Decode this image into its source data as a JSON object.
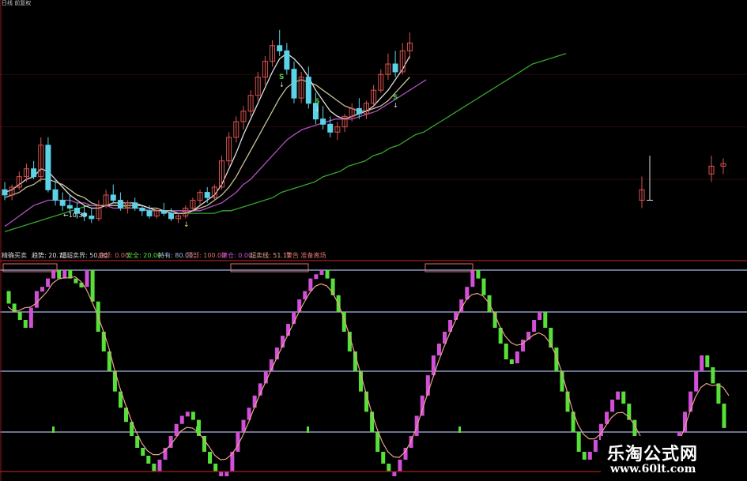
{
  "top_title": "日线 前复权",
  "colors": {
    "background": "#000000",
    "frame": "#8b1a1a",
    "up_candle": "#d9534f",
    "down_candle": "#5bd2e8",
    "ma_short": "#e0e0e0",
    "ma_mid": "#c9c19a",
    "ma_long": "#b24fc2",
    "ma_slow": "#36a62e",
    "osc_up": "#d24fd8",
    "osc_down": "#58e03a",
    "osc_line": "#e8a488",
    "level_line": "#a9b7e6",
    "buy_signal": "#4fd04f"
  },
  "indicator_labels": [
    {
      "text": "精确买卖",
      "color": "#cccccc"
    },
    {
      "text": "趋势: 20.73",
      "color": "#e0e0e0"
    },
    {
      "text": "超超卖界: 50.00",
      "color": "#cccccc"
    },
    {
      "text": "底部: 0.00",
      "color": "#e07070"
    },
    {
      "text": "安全: 20.00",
      "color": "#58e03a"
    },
    {
      "text": "持有: 80.00",
      "color": "#a9b7e6"
    },
    {
      "text": "顶部: 100.00",
      "color": "#e07070"
    },
    {
      "text": "建仓: 0.00",
      "color": "#d24fd8"
    },
    {
      "text": "超卖线: 51.17",
      "color": "#e8a488"
    },
    {
      "text": "警告 准备离场",
      "color": "#e07070"
    }
  ],
  "annotations": {
    "price_low_label": "10.33",
    "signal_marker": "S"
  },
  "watermark": {
    "name": "乐淘公式网",
    "url": "www.60lt.com"
  },
  "chart_data": [
    {
      "type": "candlestick",
      "title": "",
      "description_levels": "price panel with four moving averages",
      "candles": [
        [
          11.6,
          11.9,
          11.2,
          11.4
        ],
        [
          11.4,
          11.8,
          11.2,
          11.7
        ],
        [
          11.7,
          12.3,
          11.6,
          12.1
        ],
        [
          12.1,
          12.6,
          11.9,
          12.4
        ],
        [
          12.4,
          12.7,
          12.0,
          12.1
        ],
        [
          12.1,
          13.6,
          11.9,
          13.3
        ],
        [
          13.3,
          13.6,
          11.5,
          11.6
        ],
        [
          11.6,
          12.0,
          11.0,
          11.2
        ],
        [
          11.2,
          11.5,
          10.8,
          11.0
        ],
        [
          11.0,
          11.4,
          10.7,
          10.9
        ],
        [
          10.9,
          11.1,
          10.5,
          10.7
        ],
        [
          10.7,
          11.0,
          10.4,
          10.6
        ],
        [
          10.6,
          10.9,
          10.33,
          10.5
        ],
        [
          10.5,
          11.2,
          10.4,
          11.0
        ],
        [
          11.0,
          11.6,
          10.9,
          11.4
        ],
        [
          11.4,
          11.8,
          11.1,
          11.2
        ],
        [
          11.2,
          11.5,
          10.8,
          10.9
        ],
        [
          10.9,
          11.2,
          10.7,
          11.1
        ],
        [
          11.1,
          11.3,
          10.8,
          10.9
        ],
        [
          10.9,
          11.0,
          10.6,
          10.8
        ],
        [
          10.8,
          11.0,
          10.5,
          10.6
        ],
        [
          10.6,
          10.9,
          10.5,
          10.8
        ],
        [
          10.8,
          11.1,
          10.6,
          10.7
        ],
        [
          10.7,
          10.9,
          10.4,
          10.5
        ],
        [
          10.5,
          10.7,
          10.33,
          10.6
        ],
        [
          10.6,
          11.0,
          10.5,
          10.9
        ],
        [
          10.9,
          11.3,
          10.8,
          11.2
        ],
        [
          11.2,
          11.6,
          11.0,
          11.5
        ],
        [
          11.5,
          11.7,
          11.1,
          11.3
        ],
        [
          11.3,
          11.8,
          11.2,
          11.7
        ],
        [
          11.7,
          12.9,
          11.6,
          12.7
        ],
        [
          12.7,
          13.8,
          12.5,
          13.6
        ],
        [
          13.6,
          14.4,
          13.4,
          14.2
        ],
        [
          14.2,
          14.8,
          13.9,
          14.6
        ],
        [
          14.6,
          15.4,
          14.4,
          15.2
        ],
        [
          15.2,
          16.1,
          15.0,
          15.9
        ],
        [
          15.9,
          16.7,
          15.6,
          16.5
        ],
        [
          16.5,
          17.3,
          16.3,
          17.1
        ],
        [
          17.1,
          17.7,
          16.7,
          16.9
        ],
        [
          16.9,
          17.2,
          16.0,
          16.2
        ],
        [
          16.2,
          16.5,
          14.9,
          15.1
        ],
        [
          15.1,
          16.1,
          14.9,
          15.9
        ],
        [
          15.9,
          16.3,
          14.7,
          14.9
        ],
        [
          14.9,
          15.3,
          14.1,
          14.3
        ],
        [
          14.3,
          14.8,
          13.9,
          14.1
        ],
        [
          14.1,
          14.4,
          13.6,
          13.8
        ],
        [
          13.8,
          14.2,
          13.5,
          14.0
        ],
        [
          14.0,
          14.5,
          13.8,
          14.4
        ],
        [
          14.4,
          14.9,
          14.2,
          14.7
        ],
        [
          14.7,
          15.1,
          14.3,
          14.5
        ],
        [
          14.5,
          15.0,
          14.3,
          14.9
        ],
        [
          14.9,
          15.6,
          14.8,
          15.4
        ],
        [
          15.4,
          16.2,
          15.3,
          16.0
        ],
        [
          16.0,
          16.8,
          15.8,
          16.4
        ],
        [
          16.4,
          16.9,
          15.9,
          16.1
        ],
        [
          16.1,
          17.2,
          16.0,
          16.9
        ],
        [
          16.9,
          17.6,
          16.6,
          17.2
        ]
      ],
      "ma_short": [
        11.5,
        11.6,
        11.8,
        12.0,
        12.1,
        12.4,
        12.3,
        12.0,
        11.7,
        11.4,
        11.2,
        11.0,
        10.9,
        10.9,
        11.0,
        11.1,
        11.1,
        11.1,
        11.1,
        11.0,
        10.9,
        10.8,
        10.8,
        10.7,
        10.7,
        10.7,
        10.8,
        11.0,
        11.2,
        11.4,
        11.8,
        12.4,
        13.0,
        13.7,
        14.3,
        14.9,
        15.5,
        16.1,
        16.6,
        16.8,
        16.6,
        16.3,
        15.9,
        15.4,
        15.0,
        14.6,
        14.4,
        14.3,
        14.4,
        14.5,
        14.6,
        14.8,
        15.1,
        15.4,
        15.8,
        16.2,
        16.7
      ],
      "ma_mid": [
        11.3,
        11.4,
        11.5,
        11.7,
        11.8,
        12.0,
        12.0,
        11.9,
        11.8,
        11.6,
        11.4,
        11.3,
        11.1,
        11.0,
        11.0,
        11.0,
        11.0,
        11.0,
        11.0,
        11.0,
        10.9,
        10.9,
        10.8,
        10.8,
        10.7,
        10.7,
        10.8,
        10.9,
        11.0,
        11.2,
        11.4,
        11.7,
        12.1,
        12.6,
        13.1,
        13.6,
        14.1,
        14.6,
        15.1,
        15.5,
        15.7,
        15.8,
        15.7,
        15.6,
        15.4,
        15.2,
        15.0,
        14.8,
        14.7,
        14.6,
        14.6,
        14.7,
        14.8,
        15.0,
        15.3,
        15.6,
        15.9
      ],
      "ma_long": [
        10.2,
        10.4,
        10.6,
        10.8,
        11.0,
        11.1,
        11.2,
        11.2,
        11.2,
        11.2,
        11.1,
        11.1,
        11.0,
        11.0,
        11.0,
        10.9,
        10.9,
        10.9,
        10.9,
        10.9,
        10.8,
        10.8,
        10.8,
        10.8,
        10.8,
        10.8,
        10.8,
        10.8,
        10.9,
        11.0,
        11.1,
        11.3,
        11.5,
        11.8,
        12.0,
        12.3,
        12.6,
        12.9,
        13.2,
        13.5,
        13.7,
        13.9,
        14.0,
        14.1,
        14.2,
        14.3,
        14.3,
        14.3,
        14.4,
        14.5,
        14.6,
        14.8,
        15.0,
        15.2,
        15.4,
        15.6,
        15.8
      ],
      "ma_slow_extended": [
        10.0,
        10.1,
        10.2,
        10.3,
        10.4,
        10.5,
        10.6,
        10.7,
        10.8,
        10.9,
        11.0,
        11.0,
        11.0,
        11.0,
        11.0,
        10.9,
        10.9,
        10.8,
        10.8,
        10.8,
        10.8,
        10.8,
        10.7,
        10.7,
        10.7,
        10.7,
        10.8,
        10.8,
        10.9,
        11.0,
        11.1,
        11.2,
        11.3,
        11.5,
        11.6,
        11.7,
        11.8,
        11.9,
        12.1,
        12.2,
        12.3,
        12.5,
        12.6,
        12.7,
        12.9,
        13.0,
        13.2,
        13.3,
        13.5,
        13.7,
        13.8,
        14.0,
        14.2,
        14.4,
        14.6,
        14.8,
        15.0,
        15.2,
        15.4,
        15.6,
        15.8,
        16.0,
        16.2,
        16.4,
        16.5,
        16.6,
        16.7,
        16.8
      ]
    },
    {
      "type": "bar",
      "title": "",
      "ylim": [
        0,
        100
      ],
      "levels": [
        0,
        20,
        50,
        80,
        100
      ],
      "osc": [
        90,
        84,
        80,
        76,
        72,
        82,
        90,
        92,
        96,
        100,
        96,
        100,
        96,
        94,
        92,
        100,
        85,
        70,
        60,
        50,
        40,
        32,
        25,
        18,
        12,
        8,
        4,
        0,
        6,
        12,
        18,
        24,
        28,
        30,
        26,
        18,
        10,
        4,
        0,
        0,
        0,
        10,
        20,
        26,
        32,
        38,
        44,
        50,
        56,
        62,
        68,
        74,
        80,
        86,
        90,
        96,
        98,
        100,
        96,
        88,
        80,
        70,
        60,
        50,
        40,
        30,
        20,
        10,
        4,
        0,
        0,
        6,
        12,
        18,
        28,
        38,
        48,
        58,
        64,
        70,
        76,
        80,
        86,
        92,
        100,
        96,
        88,
        80,
        72,
        64,
        56,
        54,
        60,
        66,
        70,
        76,
        80,
        72,
        62,
        50,
        40,
        30,
        20,
        10,
        6,
        10,
        16,
        24,
        30,
        36,
        40,
        34,
        26,
        18,
        10,
        4,
        0,
        0,
        0,
        0,
        10,
        20,
        30,
        40,
        50,
        58,
        52,
        44,
        34,
        22
      ]
    }
  ]
}
